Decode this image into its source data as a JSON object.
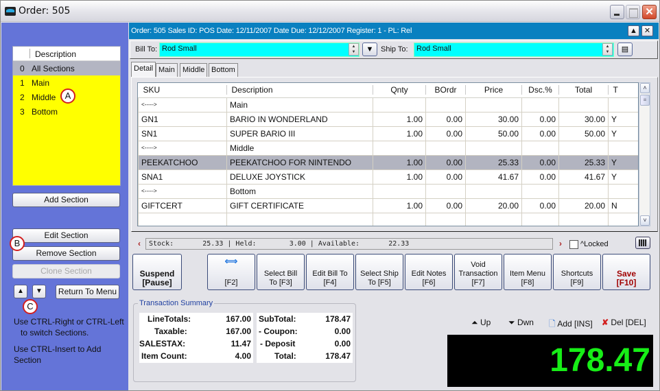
{
  "window": {
    "title": "Order: 505",
    "icon": "app-logo-icon",
    "controls": [
      "minimize",
      "maximize",
      "close"
    ]
  },
  "sections_panel": {
    "header": "Description",
    "items": [
      {
        "num": "0",
        "label": "All Sections",
        "selected": true
      },
      {
        "num": "1",
        "label": "Main",
        "selected": false
      },
      {
        "num": "2",
        "label": "Middle",
        "selected": false
      },
      {
        "num": "3",
        "label": "Bottom",
        "selected": false
      }
    ],
    "add_section": "Add Section",
    "edit_section": "Edit Section",
    "remove_section": "Remove Section",
    "clone_section": "Clone Section",
    "return_to_menu": "Return To Menu",
    "hint1_line1": "Use CTRL-Right or CTRL-Left",
    "hint1_line2": "to switch Sections.",
    "hint2": "Use CTRL-Insert to Add Section",
    "callouts": [
      "A",
      "B",
      "C"
    ]
  },
  "infobar": {
    "text": "Order: 505  Sales ID: POS  Date: 12/11/2007  Date Due: 12/12/2007  Register: 1 - PL: Rel"
  },
  "billing": {
    "bill_to_label": "Bill To:",
    "bill_to_value": "Rod Small",
    "ship_to_label": "Ship To:",
    "ship_to_value": "Rod Small"
  },
  "tabs": [
    {
      "label": "Detail",
      "active": true
    },
    {
      "label": "Main",
      "active": false
    },
    {
      "label": "Middle",
      "active": false
    },
    {
      "label": "Bottom",
      "active": false
    }
  ],
  "grid": {
    "columns": [
      "SKU",
      "Description",
      "Qnty",
      "BOrdr",
      "Price",
      "Dsc.%",
      "Total",
      "T"
    ],
    "rows": [
      {
        "sku": "<----->",
        "desc": "Main",
        "qnty": "",
        "bordr": "",
        "price": "",
        "dsc": "",
        "total": "",
        "t": "",
        "separator": true
      },
      {
        "sku": "GN1",
        "desc": "BARIO IN WONDERLAND",
        "qnty": "1.00",
        "bordr": "0.00",
        "price": "30.00",
        "dsc": "0.00",
        "total": "30.00",
        "t": "Y"
      },
      {
        "sku": "SN1",
        "desc": "SUPER BARIO III",
        "qnty": "1.00",
        "bordr": "0.00",
        "price": "50.00",
        "dsc": "0.00",
        "total": "50.00",
        "t": "Y"
      },
      {
        "sku": "<----->",
        "desc": "Middle",
        "qnty": "",
        "bordr": "",
        "price": "",
        "dsc": "",
        "total": "",
        "t": "",
        "separator": true
      },
      {
        "sku": "PEEKATCHOO",
        "desc": "PEEKATCHOO FOR NINTENDO",
        "qnty": "1.00",
        "bordr": "0.00",
        "price": "25.33",
        "dsc": "0.00",
        "total": "25.33",
        "t": "Y",
        "selected": true
      },
      {
        "sku": "SNA1",
        "desc": "DELUXE JOYSTICK",
        "qnty": "1.00",
        "bordr": "0.00",
        "price": "41.67",
        "dsc": "0.00",
        "total": "41.67",
        "t": "Y"
      },
      {
        "sku": "<----->",
        "desc": "Bottom",
        "qnty": "",
        "bordr": "",
        "price": "",
        "dsc": "",
        "total": "",
        "t": "",
        "separator": true
      },
      {
        "sku": "GIFTCERT",
        "desc": "GIFT CERTIFICATE",
        "qnty": "1.00",
        "bordr": "0.00",
        "price": "20.00",
        "dsc": "0.00",
        "total": "20.00",
        "t": "N"
      },
      {
        "sku": "",
        "desc": "",
        "qnty": "",
        "bordr": "",
        "price": "",
        "dsc": "",
        "total": "",
        "t": ""
      }
    ]
  },
  "stock_bar": {
    "text": "Stock:       25.33 | Held:        3.00 | Available:       22.33",
    "locked_label": "^Locked",
    "locked_checked": false
  },
  "function_buttons": [
    {
      "id": "suspend",
      "line1": "Suspend",
      "line2": "[Pause]"
    },
    {
      "id": "f2",
      "line1": "",
      "line2": "[F2]",
      "icon": "swap-arrows-icon"
    },
    {
      "id": "f3",
      "line1": "Select Bill",
      "line2": "To [F3]"
    },
    {
      "id": "f4",
      "line1": "Edit Bill To",
      "line2": "[F4]"
    },
    {
      "id": "f5",
      "line1": "Select Ship",
      "line2": "To [F5]"
    },
    {
      "id": "f6",
      "line1": "Edit Notes",
      "line2": "[F6]"
    },
    {
      "id": "f7",
      "line0": "Void",
      "line1": "Transaction",
      "line2": "[F7]"
    },
    {
      "id": "f8",
      "line1": "Item Menu",
      "line2": "[F8]"
    },
    {
      "id": "f9",
      "line1": "Shortcuts",
      "line2": "[F9]"
    },
    {
      "id": "f10",
      "line1": "Save",
      "line2": "[F10]"
    }
  ],
  "summary": {
    "title": "Transaction Summary",
    "left": [
      {
        "label": "LineTotals:",
        "value": "167.00"
      },
      {
        "label": "Taxable:",
        "value": "167.00"
      },
      {
        "label": "SALESTAX:",
        "value": "11.47"
      },
      {
        "label": "Item Count:",
        "value": "4.00"
      }
    ],
    "right": [
      {
        "label": "SubTotal:",
        "value": "178.47"
      },
      {
        "label": "- Coupon:",
        "value": "0.00"
      },
      {
        "label": "- Deposit",
        "value": "0.00"
      },
      {
        "label": "Total:",
        "value": "178.47"
      }
    ]
  },
  "line_controls": {
    "up": "Up",
    "down": "Dwn",
    "add": "Add [INS]",
    "delete": "Del [DEL]"
  },
  "big_total": "178.47",
  "colors": {
    "panel_blue": "#6474d8",
    "infobar_blue": "#0980c0",
    "section_yellow": "#ffff00",
    "field_cyan": "#00ffff",
    "total_green": "#17ee17",
    "save_red": "#a00000"
  }
}
